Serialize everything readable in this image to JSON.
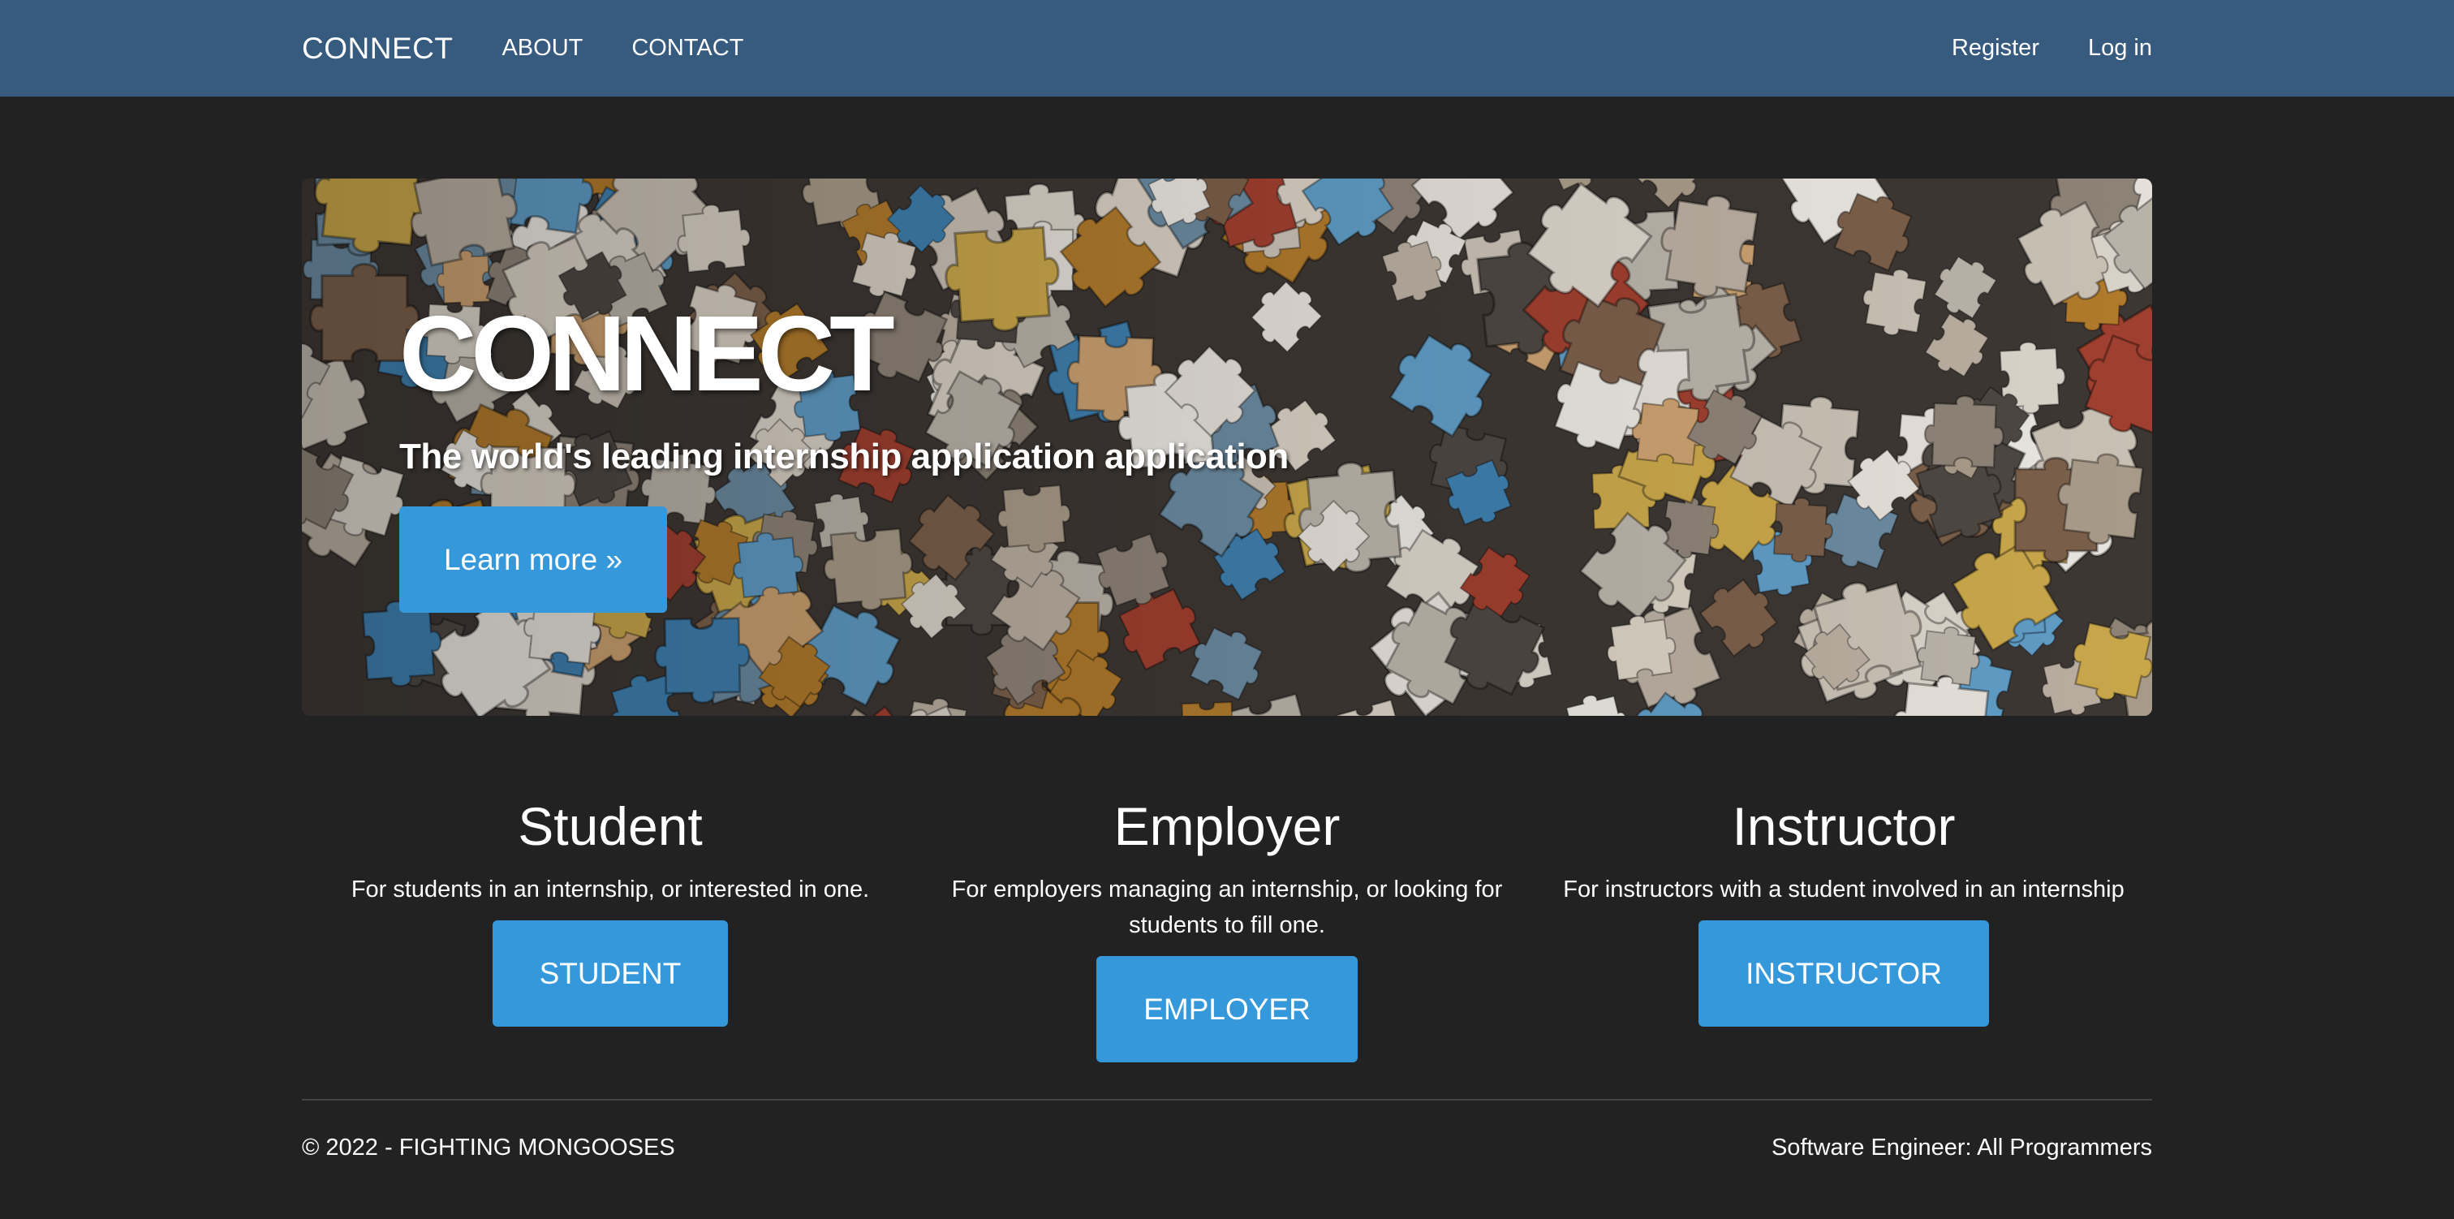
{
  "navbar": {
    "brand": "CONNECT",
    "links": [
      "ABOUT",
      "CONTACT"
    ],
    "right_links": [
      "Register",
      "Log in"
    ],
    "background": "#375a7f"
  },
  "hero": {
    "title": "CONNECT",
    "subtitle": "The world's leading internship application application",
    "button_label": "Learn more »",
    "background_image": "jigsaw-puzzle-pieces"
  },
  "roles": [
    {
      "heading": "Student",
      "description": "For students in an internship, or interested in one.",
      "button_label": "STUDENT"
    },
    {
      "heading": "Employer",
      "description": "For employers managing an internship, or looking for students to fill one.",
      "button_label": "EMPLOYER"
    },
    {
      "heading": "Instructor",
      "description": "For instructors with a student involved in an internship",
      "button_label": "INSTRUCTOR"
    }
  ],
  "footer": {
    "copyright": "© 2022 - FIGHTING MONGOOSES",
    "credit": "Software Engineer: All Programmers"
  },
  "colors": {
    "page_background": "#222222",
    "accent": "#3498db",
    "navbar": "#375a7f"
  }
}
